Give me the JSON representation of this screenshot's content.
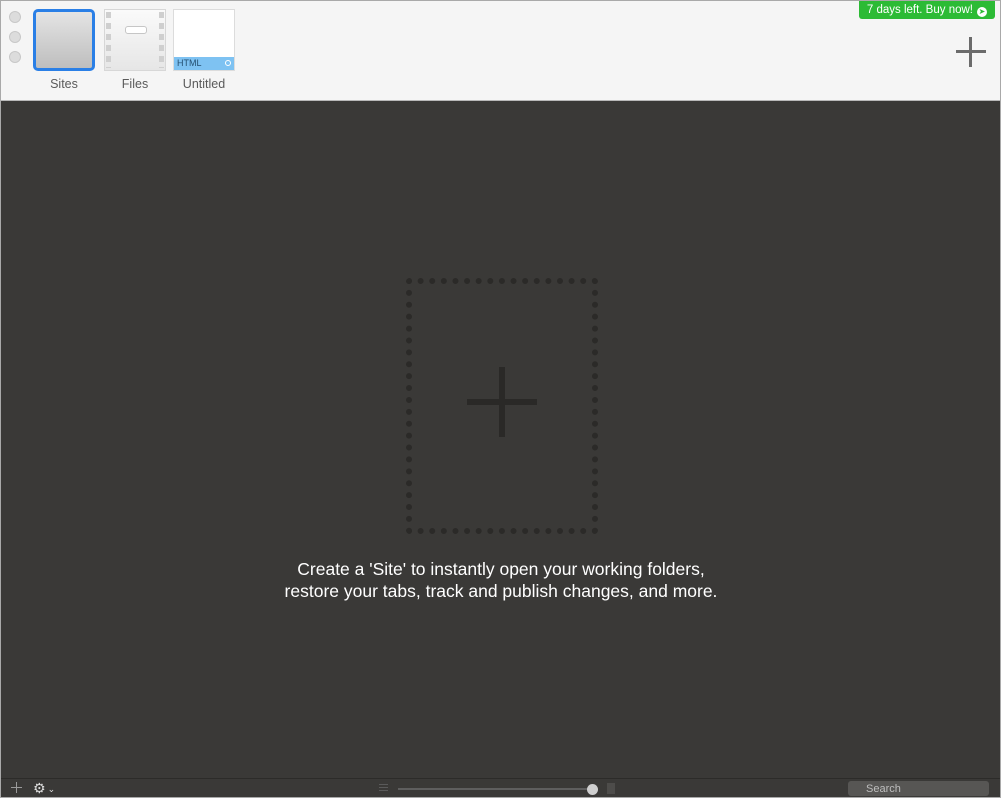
{
  "toolbar": {
    "tabs": [
      {
        "label": "Sites"
      },
      {
        "label": "Files"
      },
      {
        "label": "Untitled",
        "badge": "HTML"
      }
    ],
    "buy_badge": "7 days left. Buy now!"
  },
  "main": {
    "message_line1": "Create a 'Site' to instantly open your working folders,",
    "message_line2": "restore your tabs, track and publish changes, and more."
  },
  "bottombar": {
    "search_placeholder": "Search",
    "zoom_level": 0.98
  },
  "colors": {
    "accent": "#2a7fe6",
    "buy_green": "#2cbb35",
    "workspace": "#3a3937"
  }
}
